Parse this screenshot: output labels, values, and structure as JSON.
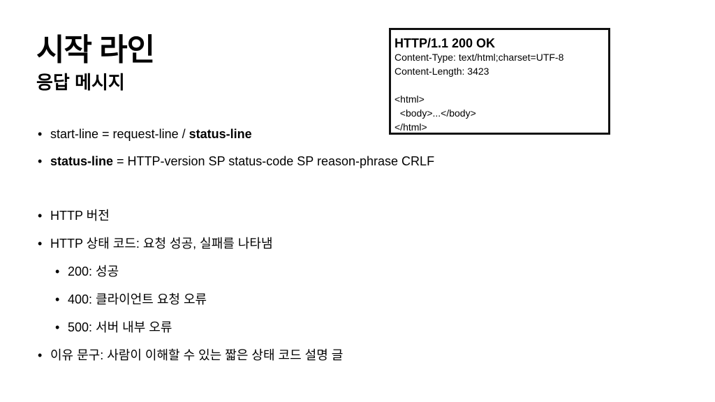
{
  "slide": {
    "title": "시작 라인",
    "subtitle": "응답 메시지"
  },
  "bullets": {
    "start_line": {
      "prefix": "start-line = request-line / ",
      "bold": "status-line"
    },
    "status_line": {
      "bold": "status-line",
      "rest": " = HTTP-version SP status-code SP reason-phrase CRLF"
    },
    "http_version": "HTTP 버전",
    "status_code": "HTTP 상태 코드: 요청 성공, 실패를 나타냄",
    "code_200": "200: 성공",
    "code_400": "400: 클라이언트 요청 오류",
    "code_500": "500: 서버 내부 오류",
    "reason_phrase": "이유 문구: 사람이 이해할 수 있는 짧은 상태 코드 설명 글"
  },
  "code_example": {
    "lines": [
      "HTTP/1.1 200 OK",
      "Content-Type: text/html;charset=UTF-8",
      "Content-Length: 3423",
      "",
      "<html>",
      "  <body>...</body>",
      "</html>"
    ]
  }
}
